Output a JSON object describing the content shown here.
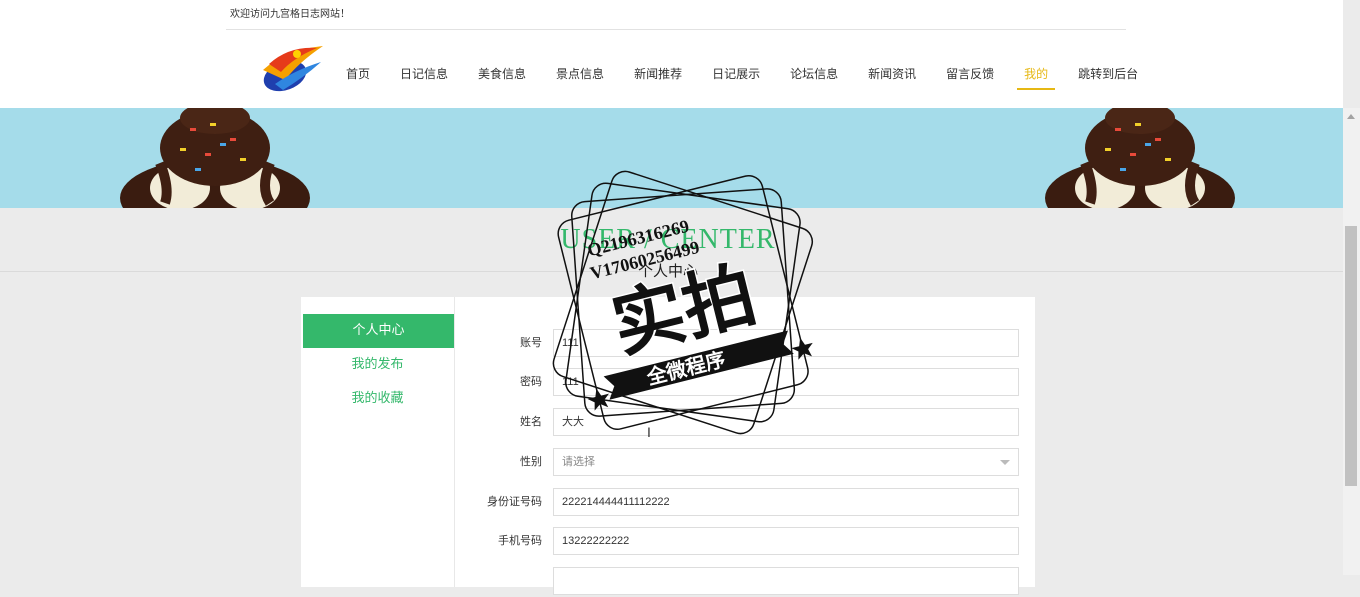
{
  "header": {
    "welcome": "欢迎访问九宫格日志网站！",
    "nav": [
      {
        "label": "首页",
        "name": "nav-home"
      },
      {
        "label": "日记信息",
        "name": "nav-diary-info"
      },
      {
        "label": "美食信息",
        "name": "nav-food-info"
      },
      {
        "label": "景点信息",
        "name": "nav-scenic-info"
      },
      {
        "label": "新闻推荐",
        "name": "nav-news-recommend"
      },
      {
        "label": "日记展示",
        "name": "nav-diary-show"
      },
      {
        "label": "论坛信息",
        "name": "nav-forum-info"
      },
      {
        "label": "新闻资讯",
        "name": "nav-news"
      },
      {
        "label": "留言反馈",
        "name": "nav-feedback"
      },
      {
        "label": "我的",
        "name": "nav-mine",
        "active": true
      },
      {
        "label": "跳转到后台",
        "name": "nav-admin"
      }
    ]
  },
  "page": {
    "title_en": "USER / CENTER",
    "title_cn": "个人中心"
  },
  "sidebar": {
    "items": [
      {
        "label": "个人中心",
        "active": true
      },
      {
        "label": "我的发布"
      },
      {
        "label": "我的收藏"
      }
    ]
  },
  "form": {
    "fields": [
      {
        "label": "账号",
        "value": "111"
      },
      {
        "label": "密码",
        "value": "111"
      },
      {
        "label": "姓名",
        "value": "大大"
      },
      {
        "label": "性别",
        "value": "请选择",
        "type": "select"
      },
      {
        "label": "身份证号码",
        "value": "222214444411112222"
      },
      {
        "label": "手机号码",
        "value": "13222222222"
      }
    ]
  },
  "watermark": {
    "line1": "Q2196316269",
    "line2": "V17060256499",
    "big": "实拍",
    "ribbon": "全微程序"
  },
  "colors": {
    "accent_green": "#34b86b",
    "nav_active": "#e6b814",
    "banner": "#a5dcea"
  }
}
